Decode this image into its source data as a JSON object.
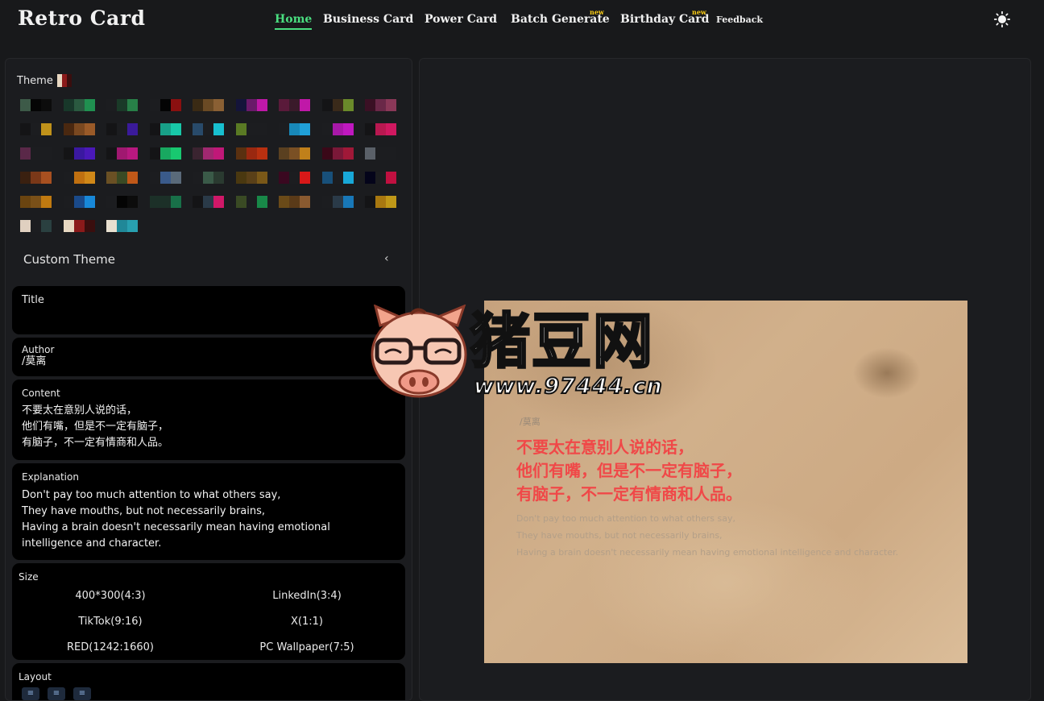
{
  "app": {
    "title": "Retro Card"
  },
  "nav": {
    "items": [
      {
        "label": "Home",
        "active": true
      },
      {
        "label": "Business Card"
      },
      {
        "label": "Power Card"
      },
      {
        "label": "Batch Generate",
        "badge": "new"
      },
      {
        "label": "Birthday Card",
        "badge": "new"
      },
      {
        "label": "Feedback"
      }
    ],
    "theme_toggle_icon": "sun-icon"
  },
  "theme": {
    "label": "Theme",
    "current_colors": [
      "#e8d8c2",
      "#8b1a1a",
      "#3a0e0e"
    ],
    "swatches": [
      [
        "#3d5a48",
        "#050505",
        "#0c0c0c"
      ],
      [
        "#18382a",
        "#2a5a40",
        "#209050"
      ],
      [
        "#1c1d20",
        "#1a3a28",
        "#288048"
      ],
      [
        "#1c1d20",
        "#040404",
        "#8a1010"
      ],
      [
        "#3a2a14",
        "#6a4a24",
        "#8a6034"
      ],
      [
        "#14143a",
        "#6a1a6a",
        "#c018a8"
      ],
      [
        "#5a1a3a",
        "#3a1a2a",
        "#c018a8"
      ],
      [
        "#141416",
        "#3a2a1a",
        "#6a8a2a"
      ],
      [
        "#3a1024",
        "#6a2848",
        "#8a3858"
      ],
      [
        "#141416",
        "#1c1d20",
        "#c0921a"
      ],
      [
        "#4a2810",
        "#7a4820",
        "#9a5a28"
      ],
      [
        "#141416",
        "#1c1d20",
        "#3a1a9a"
      ],
      [
        "#141416",
        "#18a088",
        "#18c8a8"
      ],
      [
        "#284a6a",
        "#1c1d20",
        "#18c0d0"
      ],
      [
        "#5a7a24",
        "#1c1d20",
        "#1c1d20"
      ],
      [
        "#1c1d20",
        "#1888b8",
        "#20a0d8"
      ],
      [
        "#1c1d20",
        "#a818a8",
        "#c018c0"
      ],
      [
        "#141416",
        "#b81850",
        "#d01860"
      ],
      [
        "#5a2848",
        "#1c1d20",
        "#1c1d20"
      ],
      [
        "#141416",
        "#3a18a0",
        "#4a18b8"
      ],
      [
        "#141416",
        "#a01870",
        "#b81880"
      ],
      [
        "#141416",
        "#18a860",
        "#18c870"
      ],
      [
        "#3a2430",
        "#a02870",
        "#c01878"
      ],
      [
        "#5a3010",
        "#9a2810",
        "#b83010"
      ],
      [
        "#5a4020",
        "#7a5024",
        "#c0801a"
      ],
      [
        "#3a0818",
        "#7a1838",
        "#a01838"
      ],
      [
        "#5a6068",
        "#1c1d20",
        "#1c1d20"
      ],
      [
        "#3a2010",
        "#7a3818",
        "#a85020"
      ],
      [
        "#1c1d20",
        "#c07010",
        "#d08818"
      ],
      [
        "#6a5024",
        "#3a4a24",
        "#c05818"
      ],
      [
        "#1c1d20",
        "#3a5a8a",
        "#5a6a7a"
      ],
      [
        "#1c1d20",
        "#3a5a48",
        "#2a3a30"
      ],
      [
        "#4a3810",
        "#5a4018",
        "#7a5818"
      ],
      [
        "#3a0820",
        "#1c1d20",
        "#d81818"
      ],
      [
        "#18507a",
        "#1c1d20",
        "#18a8d8"
      ],
      [
        "#04041a",
        "#1c1d20",
        "#c01040"
      ],
      [
        "#6a4410",
        "#7a5018",
        "#c07a10"
      ],
      [
        "#1c1d20",
        "#1a4a8a",
        "#1888d8"
      ],
      [
        "#1c1d20",
        "#040404",
        "#0c0c0c"
      ],
      [
        "#1c3028",
        "#1c3028",
        "#187048"
      ],
      [
        "#141416",
        "#2a3a48",
        "#d01868"
      ],
      [
        "#3a4a24",
        "#1c1d20",
        "#188848"
      ],
      [
        "#6a4a18",
        "#5a3a18",
        "#8a5a30"
      ],
      [
        "#1c1d20",
        "#2a3a48",
        "#1878b8"
      ],
      [
        "#141416",
        "#a87810",
        "#c09818"
      ],
      [
        "#e0d0c0",
        "#1c1d20",
        "#2a4040"
      ],
      [
        "#e8d8c2",
        "#8b1a1a",
        "#3a0e0e"
      ],
      [
        "#e8e0d0",
        "#208898",
        "#28a0b0"
      ]
    ],
    "custom_theme_label": "Custom Theme"
  },
  "form": {
    "title": {
      "label": "Title",
      "value": ""
    },
    "author": {
      "label": "Author",
      "value": " /莫离"
    },
    "content": {
      "label": "Content",
      "value": "不要太在意别人说的话，\n他们有嘴，但是不一定有脑子，\n有脑子，不一定有情商和人品。"
    },
    "explanation": {
      "label": "Explanation",
      "value": "Don't pay too much attention to what others say,\nThey have mouths, but not necessarily brains,\nHaving a brain doesn't necessarily mean having emotional\nintelligence and character."
    },
    "size": {
      "label": "Size",
      "options": [
        "400*300(4:3)",
        "LinkedIn(3:4)",
        "TikTok(9:16)",
        "X(1:1)",
        "RED(1242:1660)",
        "PC Wallpaper(7:5)"
      ]
    },
    "layout": {
      "label": "Layout",
      "icons": [
        "align-left-icon",
        "align-center-icon",
        "align-right-icon"
      ]
    }
  },
  "preview": {
    "author": "/莫离",
    "content": "不要太在意别人说的话，\n他们有嘴，但是不一定有脑子，\n有脑子，不一定有情商和人品。",
    "explanation": "Don't pay too much attention to what others say,\nThey have mouths, but not necessarily brains,\nHaving a brain doesn't necessarily mean having emotional intelligence and character.",
    "content_color": "#f04848"
  },
  "watermark": {
    "text": "猪豆网",
    "url": "www.97444.cn"
  }
}
